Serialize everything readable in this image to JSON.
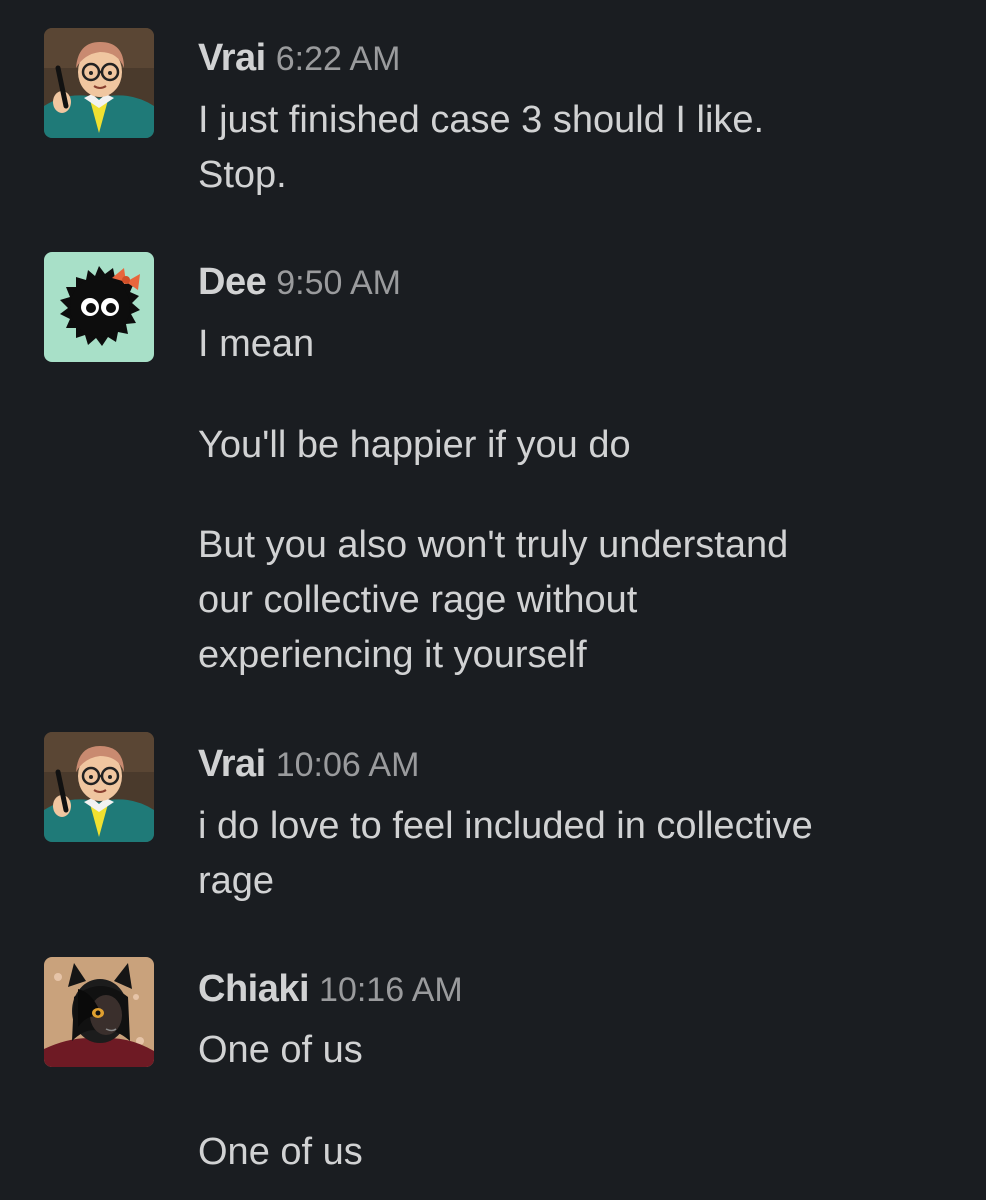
{
  "messages": [
    {
      "author": "Vrai",
      "time": "6:22 AM",
      "avatar": "vrai-avatar",
      "paragraphs": [
        "I just finished case 3 should I like.\nStop."
      ]
    },
    {
      "author": "Dee",
      "time": "9:50 AM",
      "avatar": "soot-sprite-avatar",
      "paragraphs": [
        "I mean",
        "You'll be happier if you do",
        "But you also won't truly understand\nour collective rage without\nexperiencing it yourself"
      ]
    },
    {
      "author": "Vrai",
      "time": "10:06 AM",
      "avatar": "vrai-avatar",
      "paragraphs": [
        "i do love to feel included in collective\nrage"
      ]
    },
    {
      "author": "Chiaki",
      "time": "10:16 AM",
      "avatar": "chiaki-avatar",
      "paragraphs": [
        "One of us",
        "One of us"
      ]
    }
  ],
  "colors": {
    "background": "#1a1d21",
    "text": "#d1d2d3",
    "timestamp": "#9a9b9d",
    "dee_avatar_bg": "#a8e0c8",
    "dee_bow": "#e8663c"
  }
}
